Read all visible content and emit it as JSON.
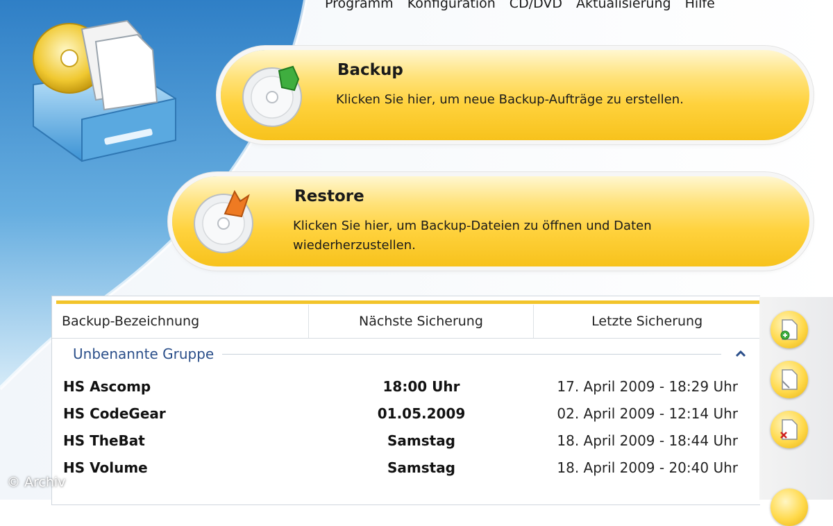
{
  "menu": {
    "items": [
      "Programm",
      "Konfiguration",
      "CD/DVD",
      "Aktualisierung",
      "Hilfe"
    ]
  },
  "actions": {
    "backup": {
      "title": "Backup",
      "description": "Klicken Sie hier, um neue Backup-Aufträge zu erstellen."
    },
    "restore": {
      "title": "Restore",
      "description": "Klicken Sie hier, um Backup-Dateien zu öffnen und Daten wiederherzustellen."
    }
  },
  "table": {
    "columns": [
      "Backup-Bezeichnung",
      "Nächste Sicherung",
      "Letzte Sicherung"
    ],
    "group": "Unbenannte Gruppe",
    "rows": [
      {
        "name": "HS Ascomp",
        "next": "18:00 Uhr",
        "last": "17. April 2009 - 18:29 Uhr"
      },
      {
        "name": "HS CodeGear",
        "next": "01.05.2009",
        "last": "02. April 2009 - 12:14 Uhr"
      },
      {
        "name": "HS TheBat",
        "next": "Samstag",
        "last": "18. April 2009 - 18:44 Uhr"
      },
      {
        "name": "HS Volume",
        "next": "Samstag",
        "last": "18. April 2009 - 20:40 Uhr"
      }
    ]
  },
  "watermark": "© Archiv",
  "colors": {
    "accent_yellow": "#ffd23d",
    "sidebar_blue": "#3f8fd0",
    "group_text": "#2b4f8a"
  },
  "icons": {
    "logo": "disc-drive-documents-icon",
    "backup": "disc-green-arrow-icon",
    "restore": "disc-orange-arrow-icon",
    "tool_add": "add-document-icon",
    "tool_edit": "edit-document-icon",
    "tool_delete": "delete-document-icon",
    "group_toggle": "chevron-up-icon"
  }
}
